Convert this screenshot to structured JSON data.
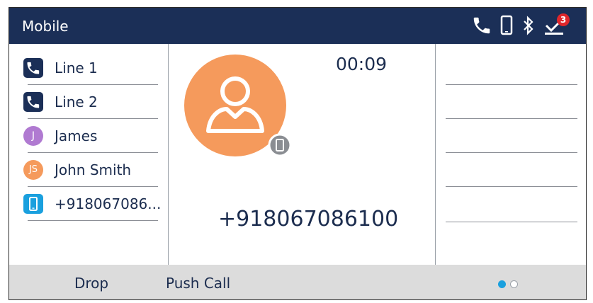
{
  "header": {
    "title": "Mobile",
    "notification_count": "3",
    "icons": [
      "phone-icon",
      "mobile-device-icon",
      "bluetooth-icon",
      "voicemail-icon"
    ]
  },
  "lines": [
    {
      "label": "Line 1",
      "icon": "phone-icon"
    },
    {
      "label": "Line 2",
      "icon": "phone-icon"
    },
    {
      "label": "James",
      "initials": "J",
      "color": "#b07ad1"
    },
    {
      "label": "John Smith",
      "initials": "JS",
      "color": "#f59a5c"
    },
    {
      "label": "+918067086...",
      "icon": "mobile-device-icon",
      "color": "#1aa0de"
    }
  ],
  "call": {
    "timer": "00:09",
    "number": "+918067086100",
    "avatar_color": "#f59a5c"
  },
  "softkeys": {
    "drop": "Drop",
    "push_call": "Push Call"
  },
  "pager": {
    "pages": 2,
    "active": 1
  },
  "colors": {
    "header_bg": "#1b2f57",
    "text": "#1c2d4f",
    "accent_blue": "#1aa0de",
    "badge_red": "#e0262b",
    "softkey_bg": "#dcdcdc"
  }
}
